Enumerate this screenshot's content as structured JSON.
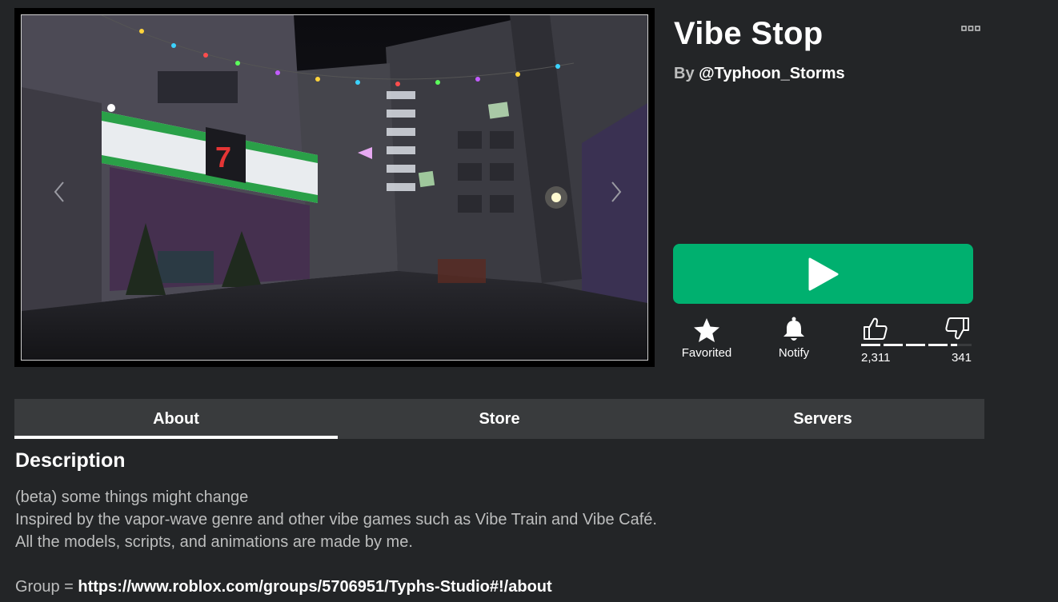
{
  "game": {
    "title": "Vibe Stop",
    "creator_prefix": "By ",
    "creator_name": "@Typhoon_Storms",
    "more_icon": "ellipsis-icon",
    "play_icon": "play-icon",
    "play_color": "#00b06f"
  },
  "actions": {
    "favorite_label": "Favorited",
    "notify_label": "Notify",
    "upvotes": "2,311",
    "downvotes": "341",
    "upvote_ratio": 0.871
  },
  "tabs": [
    {
      "label": "About",
      "active": true
    },
    {
      "label": "Store",
      "active": false
    },
    {
      "label": "Servers",
      "active": false
    }
  ],
  "description": {
    "heading": "Description",
    "lines": [
      "(beta) some things might change",
      "Inspired by the vapor-wave genre and other vibe games such as Vibe Train and Vibe Café.",
      "All the models, scripts, and animations are made by me."
    ],
    "group_label": "Group = ",
    "group_link": "https://www.roblox.com/groups/5706951/Typhs-Studio#!/about"
  },
  "colors": {
    "background": "#232527",
    "tab_bar": "#393b3d",
    "secondary_text": "#bdbebe"
  }
}
